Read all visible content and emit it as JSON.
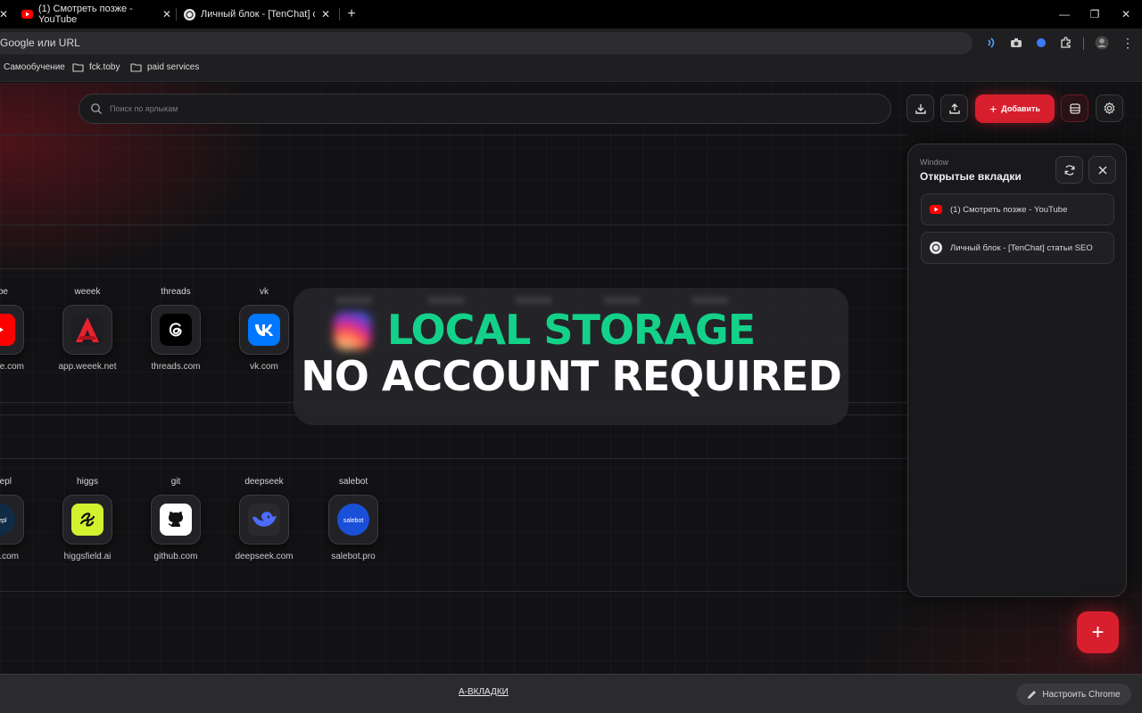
{
  "browser": {
    "tabs": [
      {
        "title": "(1) Смотреть позже - YouTube",
        "icon": "youtube-icon",
        "active": true
      },
      {
        "title": "Личный блок - [TenChat] статьи",
        "icon": "openai-icon",
        "active": false
      }
    ],
    "new_tab_label": "+",
    "omnibox_text": "Google или URL",
    "bookmarks": [
      {
        "label": "Самообучение",
        "icon": "none"
      },
      {
        "label": "fck.toby",
        "icon": "folder-icon"
      },
      {
        "label": "paid services",
        "icon": "folder-icon"
      }
    ]
  },
  "header": {
    "search_placeholder": "Поиск по ярлыкам",
    "add_button_label": "Добавить",
    "add_button_icon": "+"
  },
  "groups": [
    {
      "shortcuts": [
        {
          "name": "tube",
          "domain": "pe.com",
          "logo_bg": "#ff0000",
          "icon": "youtube-icon"
        },
        {
          "name": "weeek",
          "domain": "app.weeek.net",
          "logo_bg": "#1e1e22",
          "icon": "weeek-icon"
        },
        {
          "name": "threads",
          "domain": "threads.com",
          "logo_bg": "#000000",
          "icon": "threads-icon"
        },
        {
          "name": "vk",
          "domain": "vk.com",
          "logo_bg": "#0077ff",
          "icon": "vk-icon"
        }
      ]
    },
    {
      "shortcuts": [
        {
          "name": "epl",
          "domain": ".com",
          "logo_bg": "#0f2b46",
          "icon": "deepl-icon"
        },
        {
          "name": "higgs",
          "domain": "higgsfield.ai",
          "logo_bg": "#d2f22f",
          "icon": "higgs-icon"
        },
        {
          "name": "git",
          "domain": "github.com",
          "logo_bg": "#ffffff",
          "icon": "github-icon"
        },
        {
          "name": "deepseek",
          "domain": "deepseek.com",
          "logo_bg": "#2a2a2e",
          "icon": "deepseek-icon"
        },
        {
          "name": "salebot",
          "domain": "salebot.pro",
          "logo_bg": "#1a4fd8",
          "icon": "salebot-icon"
        }
      ]
    }
  ],
  "overlay": {
    "line1": "LOCAL STORAGE",
    "line2": "NO ACCOUNT REQUIRED",
    "line1_color": "#14d18a",
    "line2_color": "#ffffff"
  },
  "panel": {
    "caption": "Window",
    "title": "Открытые вкладки",
    "tabs": [
      {
        "title": "(1) Смотреть позже - YouTube",
        "icon": "youtube-icon"
      },
      {
        "title": "Личный блок - [TenChat] статьи SEO",
        "icon": "openai-icon"
      }
    ]
  },
  "footer": {
    "link": "А-ВКЛАДКИ",
    "customize": "Настроить Chrome"
  },
  "colors": {
    "accent": "#d81f2e",
    "background": "#121214",
    "panel": "#19191c"
  }
}
